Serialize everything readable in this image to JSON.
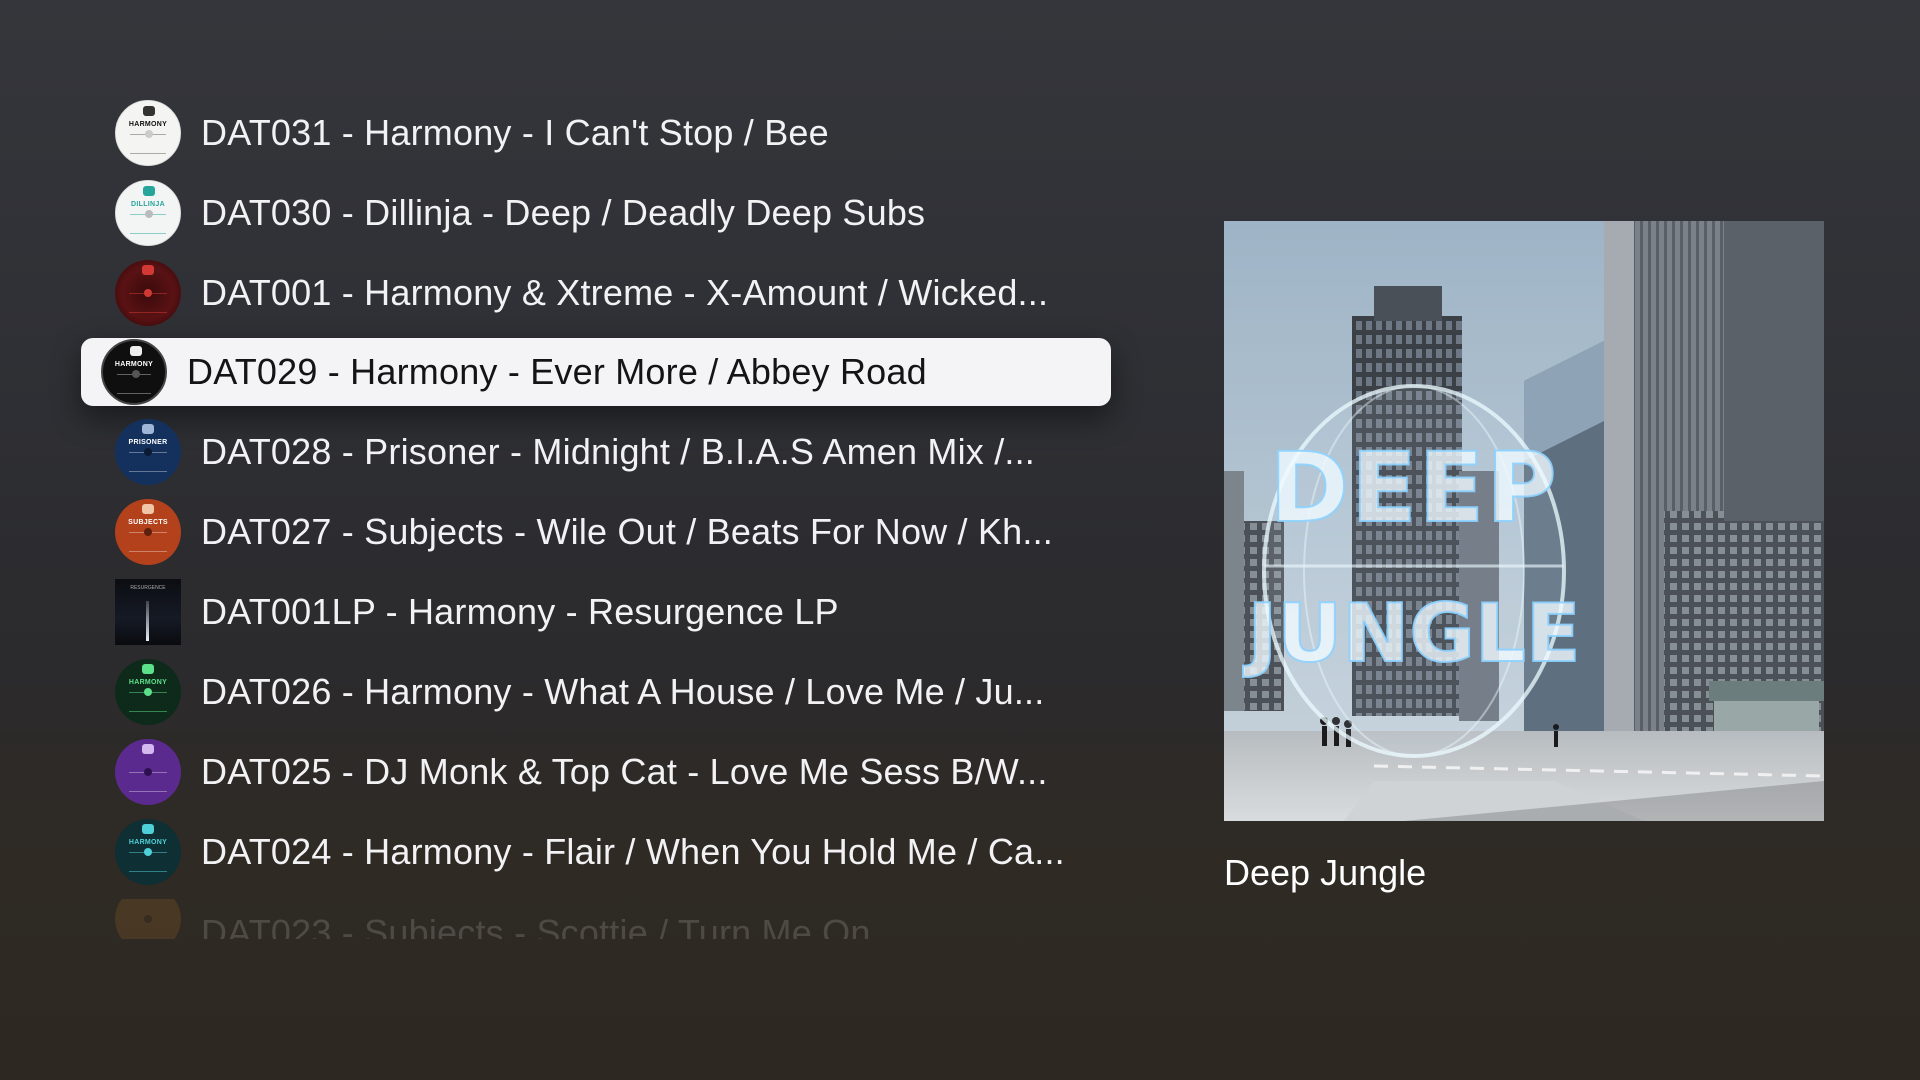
{
  "releases": [
    {
      "title": "DAT031 - Harmony - I Can't Stop / Bee",
      "label_text": "HARMONY",
      "disc_color": "#f4f4f2",
      "ink": "#111111"
    },
    {
      "title": "DAT030 - Dillinja - Deep / Deadly Deep Subs",
      "label_text": "DILLINJA",
      "disc_color": "#f3f5f5",
      "ink": "#27a59b"
    },
    {
      "title": "DAT001 - Harmony & Xtreme - X-Amount / Wicked...",
      "label_text": "",
      "disc_color": "#5a1214",
      "ink": "#d13a34"
    },
    {
      "title": "DAT029 - Harmony - Ever More / Abbey Road",
      "label_text": "HARMONY",
      "disc_color": "#0f0f10",
      "ink": "#ffffff"
    },
    {
      "title": "DAT028 - Prisoner - Midnight / B.I.A.S Amen Mix /...",
      "label_text": "PRISONER",
      "disc_color": "#14315e",
      "ink": "#ffffff"
    },
    {
      "title": "DAT027 - Subjects - Wile Out / Beats For Now / Kh...",
      "label_text": "SUBJECTS",
      "disc_color": "#b3421c",
      "ink": "#ffffff"
    },
    {
      "title": "DAT001LP - Harmony - Resurgence LP",
      "label_text": "RESURGENCE",
      "disc_color": "#0d0f14",
      "ink": "#ffffff"
    },
    {
      "title": "DAT026 - Harmony - What A House / Love Me / Ju...",
      "label_text": "HARMONY",
      "disc_color": "#0d2a1a",
      "ink": "#5de08a"
    },
    {
      "title": "DAT025 - DJ Monk & Top Cat - Love Me Sess B/W...",
      "label_text": "",
      "disc_color": "#5a2a8e",
      "ink": "#ffffff"
    },
    {
      "title": "DAT024 - Harmony - Flair / When You Hold Me / Ca...",
      "label_text": "HARMONY",
      "disc_color": "#0e2f33",
      "ink": "#4fd0d8"
    },
    {
      "title": "DAT023 - Subjects - Scottie / Turn Me On",
      "label_text": "",
      "disc_color": "#c8802a",
      "ink": "#ffffff"
    }
  ],
  "focused_index": 3,
  "artwork": {
    "title": "Deep Jungle",
    "cover_text_top": "DEEP",
    "cover_text_bottom": "JUNGLE"
  }
}
